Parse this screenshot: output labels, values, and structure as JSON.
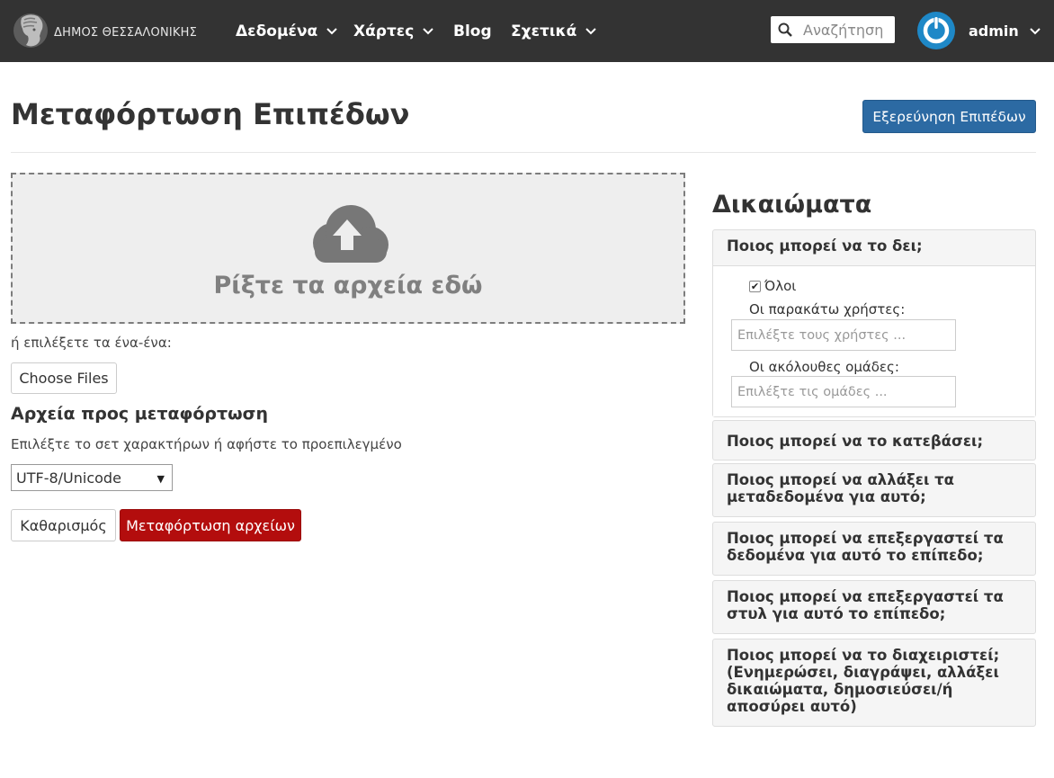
{
  "navbar": {
    "brand_text": "ΔΗΜΟΣ ΘΕΣΣΑΛΟΝΙΚΗΣ",
    "items": [
      {
        "label": "Δεδομένα",
        "has_dropdown": true
      },
      {
        "label": "Χάρτες",
        "has_dropdown": true
      },
      {
        "label": "Blog",
        "has_dropdown": false
      },
      {
        "label": "Σχετικά",
        "has_dropdown": true
      }
    ],
    "search_placeholder": "Αναζήτηση",
    "user_name": "admin",
    "colors": {
      "bar": "#333333",
      "avatar": "#1e88c7"
    }
  },
  "header": {
    "title": "Μεταφόρτωση Επιπέδων",
    "explore_button": "Εξερεύνηση Επιπέδων"
  },
  "upload": {
    "drop_text": "Ρίξτε τα αρχεία εδώ",
    "or_text": "ή επιλέξετε τα ένα-ένα:",
    "choose_files": "Choose Files",
    "files_heading": "Αρχεία προς μεταφόρτωση",
    "charset_label": "Επιλέξτε το σετ χαρακτήρων ή αφήστε το προεπιλεγμένο",
    "charset_value": "UTF-8/Unicode",
    "clear_button": "Καθαρισμός",
    "upload_button": "Μεταφόρτωση αρχείων",
    "colors": {
      "upload_button": "#b30d0d",
      "explore_button": "#2c6aa3"
    }
  },
  "permissions": {
    "title": "Δικαιώματα",
    "view": {
      "heading": "Ποιος μπορεί να το δει;",
      "all_label": "Όλοι",
      "all_checked": true,
      "users_label": "Οι παρακάτω χρήστες:",
      "users_placeholder": "Επιλέξτε τους χρήστες ...",
      "groups_label": "Οι ακόλουθες ομάδες:",
      "groups_placeholder": "Επιλέξτε τις ομάδες ..."
    },
    "download": "Ποιος μπορεί να το κατεβάσει;",
    "metadata_line1": "Ποιος μπορεί να αλλάξει τα",
    "metadata_line2": "μεταδεδομένα για αυτό;",
    "edit_data_line1": "Ποιος μπορεί να επεξεργαστεί τα",
    "edit_data_line2": "δεδομένα για αυτό το επίπεδο;",
    "edit_style_line1": "Ποιος μπορεί να επεξεργαστεί τα",
    "edit_style_line2": "στυλ για αυτό το επίπεδο;",
    "manage_line1": "Ποιος μπορεί να το διαχειριστεί;",
    "manage_line2": "(Ενημερώσει, διαγράψει, αλλάξει",
    "manage_line3": "δικαιώματα, δημοσιεύσει/ή",
    "manage_line4": "αποσύρει αυτό)"
  }
}
